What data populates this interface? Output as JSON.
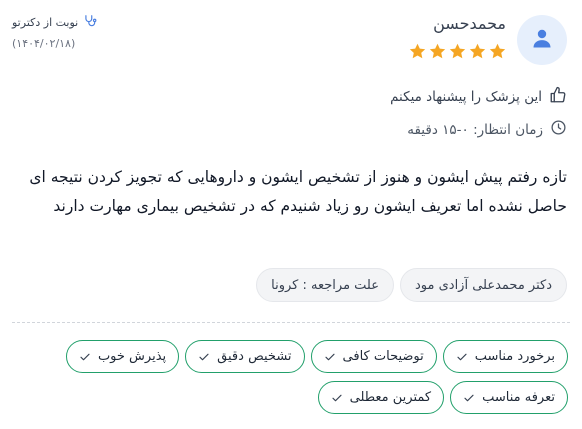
{
  "user": {
    "name": "محمدحسن",
    "avatar_icon": "user-icon",
    "rating": 5,
    "rating_max": 5
  },
  "booking": {
    "label": "نوبت از دکترتو",
    "icon": "stethoscope-icon",
    "date": "(۱۴۰۴/۰۲/۱۸)"
  },
  "recommend": {
    "icon": "thumbs-up-icon",
    "text": "این پزشک را پیشنهاد میکنم"
  },
  "wait": {
    "icon": "clock-icon",
    "text": "زمان انتظار: ۰-۱۵ دقیقه"
  },
  "comment": "تازه رفتم پیش ایشون و هنوز از تشخیص ایشون و داروهایی که تجویز کردن نتیجه ای حاصل نشده اما تعریف ایشون رو زیاد شنیدم که در تشخیص بیماری مهارت دارند",
  "tags": {
    "doctor": "دکتر محمدعلی آزادی مود",
    "reason": "علت مراجعه : کرونا"
  },
  "feedback": [
    "برخورد مناسب",
    "توضیحات کافی",
    "تشخیص دقیق",
    "پذیرش خوب",
    "تعرفه مناسب",
    "کمترین معطلی"
  ],
  "colors": {
    "star": "#f5a623",
    "chip_border": "#22a06b",
    "avatar_bg": "#e6effc",
    "avatar_fg": "#4a7fe0"
  }
}
